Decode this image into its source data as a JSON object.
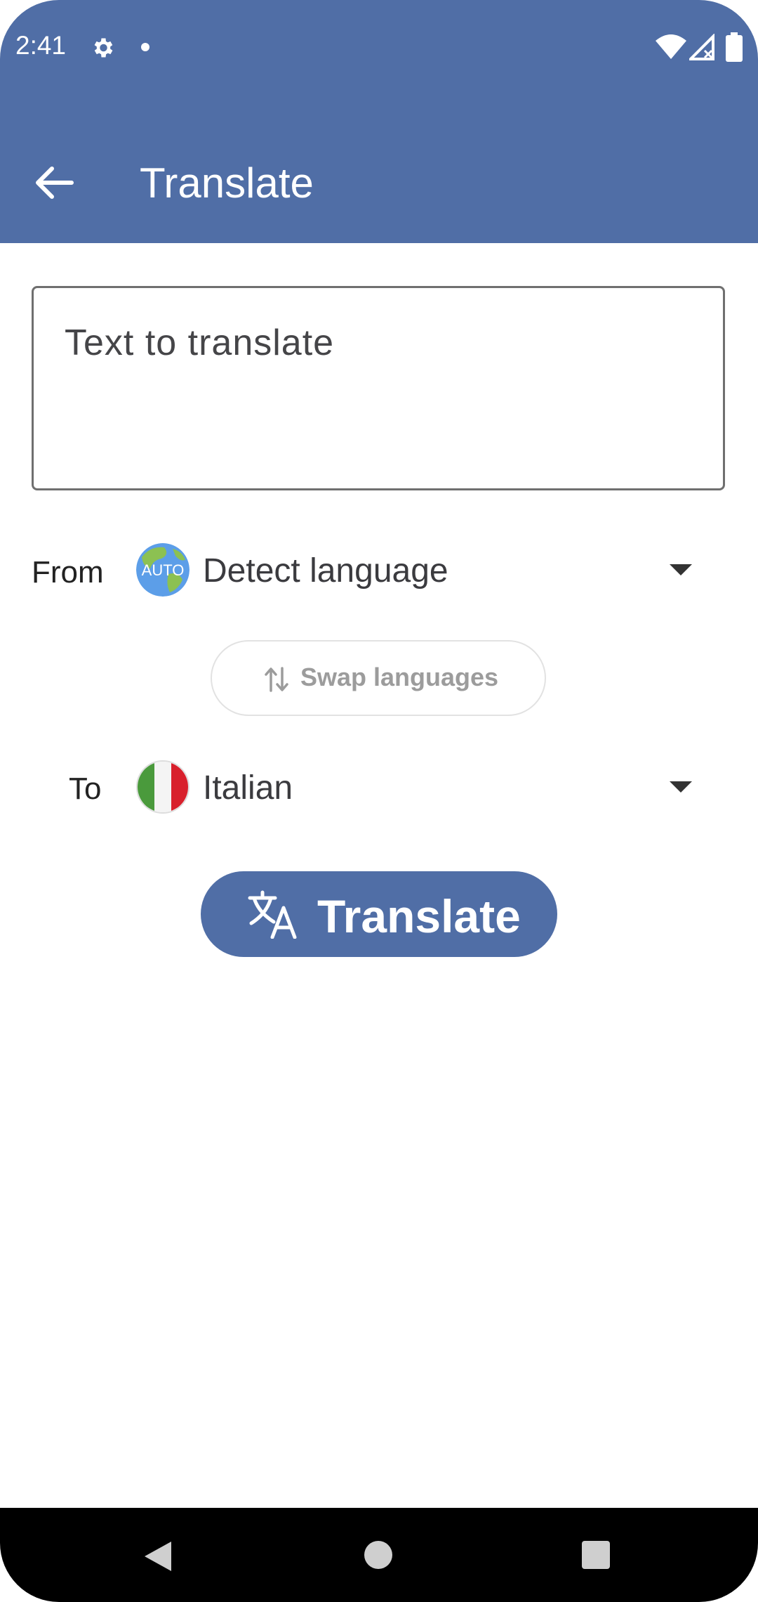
{
  "status_bar": {
    "time": "2:41",
    "icons": [
      "settings-icon",
      "notification-dot-icon",
      "wifi-icon",
      "signal-icon",
      "battery-icon"
    ]
  },
  "app_bar": {
    "title": "Translate",
    "back_icon": "arrow-back-icon",
    "background": "#506ea6"
  },
  "input": {
    "placeholder": "Text to translate"
  },
  "from": {
    "label": "From",
    "language": "Detect language",
    "flag_text": "AUTO"
  },
  "swap": {
    "label": "Swap languages",
    "icon": "swap-vertical-icon"
  },
  "to": {
    "label": "To",
    "language": "Italian"
  },
  "translate_button": {
    "label": "Translate",
    "icon": "translate-icon"
  },
  "nav_bar": {
    "icons": [
      "back-triangle-icon",
      "home-circle-icon",
      "recents-square-icon"
    ]
  }
}
